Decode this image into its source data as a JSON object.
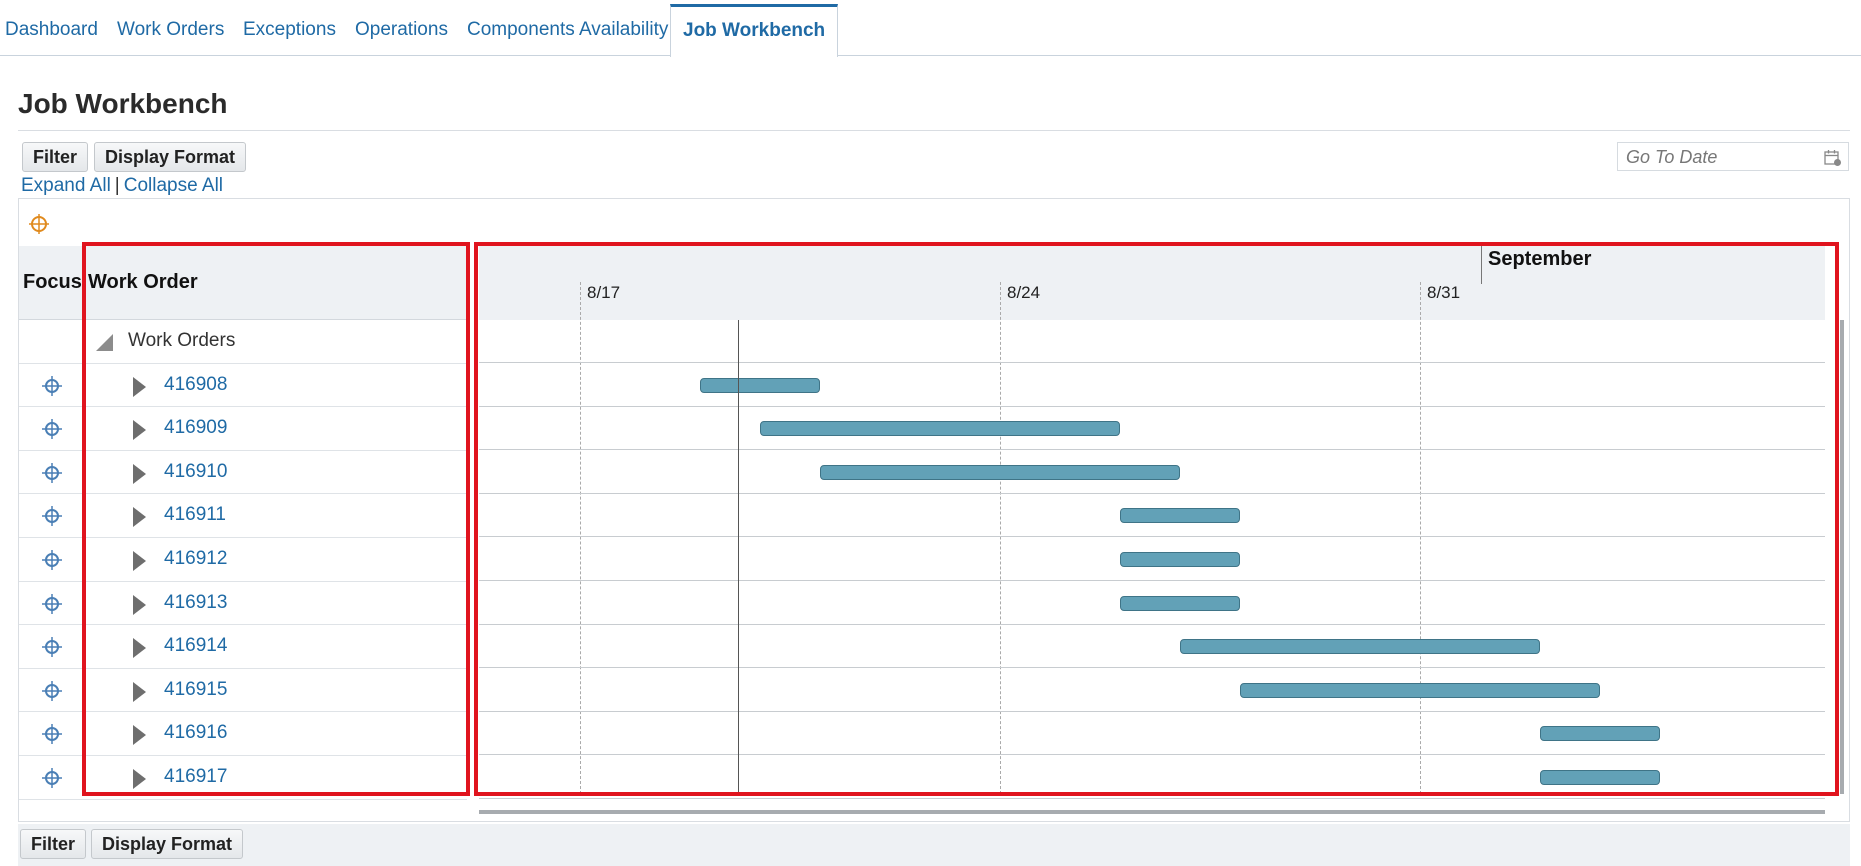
{
  "tabs": [
    {
      "label": "Dashboard",
      "active": false
    },
    {
      "label": "Work Orders",
      "active": false
    },
    {
      "label": "Exceptions",
      "active": false
    },
    {
      "label": "Operations",
      "active": false
    },
    {
      "label": "Components Availability",
      "active": false
    },
    {
      "label": "Job Workbench",
      "active": true
    }
  ],
  "page": {
    "title": "Job Workbench"
  },
  "toolbar": {
    "filter_label": "Filter",
    "display_format_label": "Display Format"
  },
  "links": {
    "expand_all": "Expand All",
    "separator": "|",
    "collapse_all": "Collapse All"
  },
  "go_to_date": {
    "placeholder": "Go To Date",
    "icon": "calendar-icon"
  },
  "table": {
    "focus_header": "Focus",
    "work_order_header": "Work Order",
    "root_label": "Work Orders",
    "rows": [
      {
        "id": "416908",
        "start": "8/19",
        "end": "8/21"
      },
      {
        "id": "416909",
        "start": "8/20",
        "end": "8/26"
      },
      {
        "id": "416910",
        "start": "8/21",
        "end": "8/27"
      },
      {
        "id": "416911",
        "start": "8/26",
        "end": "8/28"
      },
      {
        "id": "416912",
        "start": "8/26",
        "end": "8/28"
      },
      {
        "id": "416913",
        "start": "8/26",
        "end": "8/28"
      },
      {
        "id": "416914",
        "start": "8/27",
        "end": "9/2"
      },
      {
        "id": "416915",
        "start": "8/28",
        "end": "9/3"
      },
      {
        "id": "416916",
        "start": "9/2",
        "end": "9/4"
      },
      {
        "id": "416917",
        "start": "9/2",
        "end": "9/4"
      }
    ]
  },
  "gantt": {
    "month_label": "September",
    "date_labels": [
      "8/17",
      "8/24",
      "8/31"
    ],
    "bar_color": "#62a1b7"
  },
  "bottom_toolbar": {
    "filter_label": "Filter",
    "display_format_label": "Display Format"
  },
  "colors": {
    "link": "#1f6aa5",
    "highlight": "#e0141e",
    "header_bg": "#eef1f4"
  }
}
